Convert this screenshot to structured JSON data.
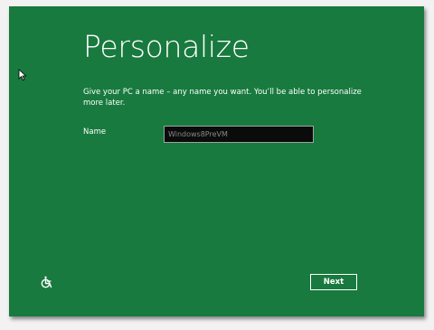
{
  "colors": {
    "background": "#187a3e",
    "text": "#ffffff",
    "field_background": "#0b0b0b",
    "field_text": "#8a8a8a"
  },
  "page": {
    "title": "Personalize",
    "description": "Give your PC a name – any name you want. You’ll be able to personalize more later."
  },
  "form": {
    "name_label": "Name",
    "name_value": "Windows8PreVM"
  },
  "footer": {
    "next_label": "Next",
    "accessibility_icon": "ease-of-access-icon"
  },
  "cursor_icon": "mouse-pointer-icon"
}
